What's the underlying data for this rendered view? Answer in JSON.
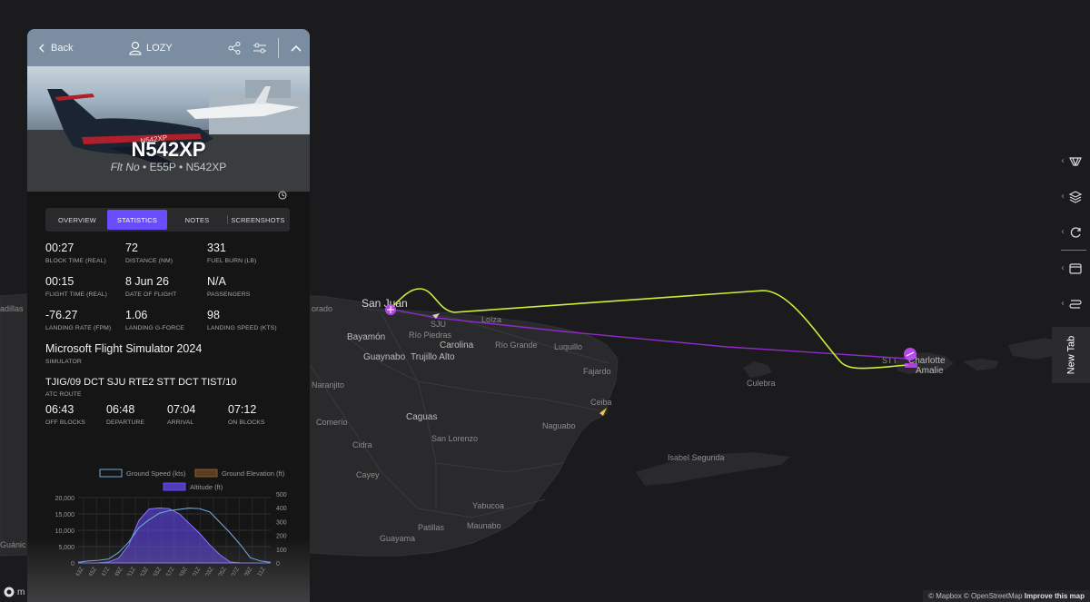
{
  "header": {
    "back_label": "Back",
    "user_label": "LOZY"
  },
  "aircraft": {
    "registration": "N542XP",
    "flight_prefix": "Flt No",
    "type": "E55P",
    "reg_repeat": "N542XP",
    "livery_text": "N542XP"
  },
  "tabs": [
    {
      "label": "OVERVIEW",
      "active": false
    },
    {
      "label": "STATISTICS",
      "active": true
    },
    {
      "label": "NOTES",
      "active": false
    },
    {
      "label": "SCREENSHOTS",
      "active": false
    }
  ],
  "stats": {
    "block_time": {
      "value": "00:27",
      "label": "BLOCK TIME (REAL)"
    },
    "distance": {
      "value": "72",
      "label": "DISTANCE (NM)"
    },
    "fuel_burn": {
      "value": "331",
      "label": "FUEL BURN (LB)"
    },
    "flight_time": {
      "value": "00:15",
      "label": "FLIGHT TIME (REAL)"
    },
    "date": {
      "value": "8 Jun 26",
      "label": "DATE OF FLIGHT"
    },
    "passengers": {
      "value": "N/A",
      "label": "PASSENGERS"
    },
    "landing_rate": {
      "value": "-76.27",
      "label": "LANDING RATE (FPM)"
    },
    "landing_g": {
      "value": "1.06",
      "label": "LANDING G-FORCE"
    },
    "landing_speed": {
      "value": "98",
      "label": "LANDING SPEED (KTS)"
    },
    "simulator": {
      "value": "Microsoft Flight Simulator 2024",
      "label": "SIMULATOR"
    },
    "atc_route": {
      "value": "TJIG/09 DCT SJU RTE2 STT DCT TIST/10",
      "label": "ATC ROUTE"
    },
    "off_blocks": {
      "value": "06:43",
      "label": "OFF BLOCKS"
    },
    "departure": {
      "value": "06:48",
      "label": "DEPARTURE"
    },
    "arrival": {
      "value": "07:04",
      "label": "ARRIVAL"
    },
    "on_blocks": {
      "value": "07:12",
      "label": "ON BLOCKS"
    }
  },
  "chart_data": {
    "type": "area",
    "legend": [
      {
        "name": "Ground Speed (kts)",
        "color": "#6fa8dc"
      },
      {
        "name": "Ground Elevation (ft)",
        "color": "#8a5a2b"
      },
      {
        "name": "Altitude (ft)",
        "color": "#6a4cff"
      }
    ],
    "y_left_ticks": [
      "20,000",
      "15,000",
      "10,000",
      "5,000",
      "0"
    ],
    "y_right_ticks": [
      "500",
      "400",
      "300",
      "200",
      "100",
      "0"
    ],
    "ylim_left": [
      0,
      20000
    ],
    "ylim_right": [
      0,
      500
    ],
    "x_ticks": [
      "19:43Z",
      "19:45Z",
      "19:47Z",
      "19:49Z",
      "19:51Z",
      "19:53Z",
      "19:55Z",
      "19:57Z",
      "19:59Z",
      "20:01Z",
      "20:03Z",
      "20:05Z",
      "20:07Z",
      "20:09Z",
      "20:11Z"
    ],
    "altitude": [
      0,
      0,
      50,
      300,
      1500,
      5500,
      13000,
      16500,
      16800,
      16600,
      15000,
      12000,
      9000,
      5500,
      2500,
      300,
      50,
      0,
      0,
      0
    ],
    "ground_speed": [
      5,
      15,
      20,
      30,
      80,
      160,
      270,
      330,
      380,
      400,
      410,
      420,
      415,
      390,
      310,
      230,
      140,
      40,
      15,
      5
    ]
  },
  "map": {
    "places": [
      "San Juan",
      "Bayamón",
      "Guaynabo",
      "Carolina",
      "Trujillo Alto",
      "Río Piedras",
      "Loíza",
      "Río Grande",
      "Luquillo",
      "Fajardo",
      "Ceiba",
      "Naguabo",
      "Culebra",
      "Caguas",
      "San Lorenzo",
      "Comerío",
      "Naranjito",
      "Cidra",
      "Cayey",
      "Yabucoa",
      "Patillas",
      "Maunabo",
      "Guayama",
      "Isabel Segunda",
      "Charlotte Amalie",
      "STT",
      "SJU",
      "orado",
      "adillas",
      "Guánic"
    ],
    "route_colors": {
      "actual": "#c8f03c",
      "planned": "#8e2bc9",
      "accent": "#c84cff"
    }
  },
  "toolbar": {
    "new_tab_label": "New Tab"
  },
  "attribution": {
    "mapbox": "© Mapbox",
    "osm": "© OpenStreetMap",
    "improve": "Improve this map",
    "logo_text": "m"
  }
}
